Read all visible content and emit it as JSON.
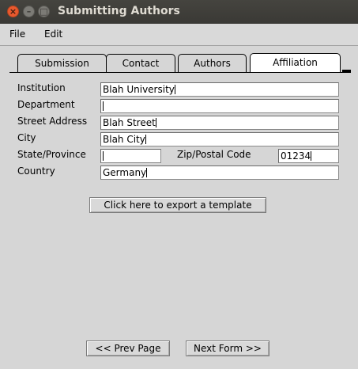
{
  "window": {
    "title": "Submitting Authors"
  },
  "menu": {
    "file": "File",
    "edit": "Edit"
  },
  "tabs": [
    {
      "label": "Submission"
    },
    {
      "label": "Contact"
    },
    {
      "label": "Authors"
    },
    {
      "label": "Affiliation",
      "active": true
    }
  ],
  "form": {
    "institution": {
      "label": "Institution",
      "value": "Blah University"
    },
    "department": {
      "label": "Department",
      "value": ""
    },
    "street": {
      "label": "Street Address",
      "value": "Blah Street"
    },
    "city": {
      "label": "City",
      "value": "Blah City"
    },
    "state": {
      "label": "State/Province",
      "value": ""
    },
    "zip": {
      "label": "Zip/Postal Code",
      "value": "01234"
    },
    "country": {
      "label": "Country",
      "value": "Germany"
    }
  },
  "buttons": {
    "export": "Click here to export a template",
    "prev": "<< Prev Page",
    "next": "Next Form >>"
  }
}
